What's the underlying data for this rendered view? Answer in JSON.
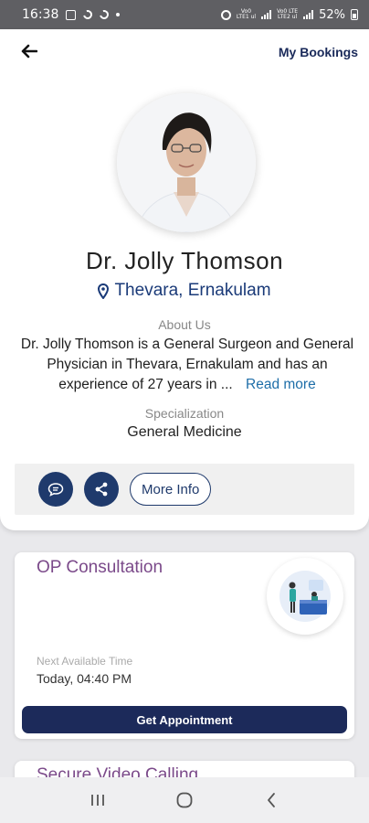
{
  "status_bar": {
    "time": "16:38",
    "net1_top": "Vo0",
    "net1_bottom": "LTE1 ul",
    "net2_top": "Vo0 LTE",
    "net2_bottom": "LTE2 ul",
    "battery": "52%"
  },
  "header": {
    "bookings_label": "My Bookings"
  },
  "doctor": {
    "name": "Dr. Jolly Thomson",
    "location": "Thevara, Ernakulam",
    "about_label": "About Us",
    "about_text": "Dr. Jolly Thomson is a General Surgeon and General Physician in Thevara, Ernakulam and has an experience of 27 years in ...",
    "read_more": "Read more",
    "specialization_label": "Specialization",
    "specialization": "General Medicine"
  },
  "actions": {
    "more_info_label": "More Info"
  },
  "op_consultation": {
    "title": "OP Consultation",
    "next_label": "Next Available Time",
    "next_time": "Today, 04:40 PM",
    "button_label": "Get Appointment"
  },
  "video_calling": {
    "title": "Secure Video Calling"
  },
  "icons": {
    "back": "arrow-left-icon",
    "location": "map-pin-icon",
    "chat": "chat-bubble-icon",
    "share": "share-icon",
    "nav_recent": "recent-apps-icon",
    "nav_home": "home-icon",
    "nav_back": "chevron-left-icon"
  },
  "colors": {
    "primary": "#1f3a6c",
    "accent_title": "#7b4a8a",
    "link": "#1e6ea8",
    "status_bar": "#5f5f63"
  }
}
